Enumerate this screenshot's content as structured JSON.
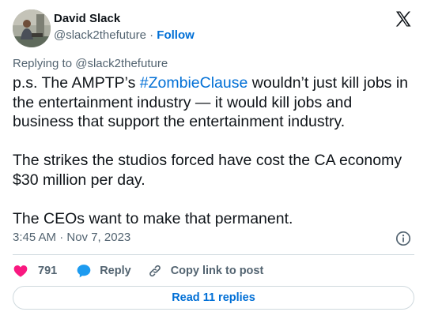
{
  "author": {
    "name": "David Slack",
    "handle": "@slack2thefuture",
    "separator": "·",
    "follow_label": "Follow"
  },
  "replying_to": "Replying to @slack2thefuture",
  "tweet": {
    "line1_prefix": "p.s. The AMPTP’s ",
    "hashtag": "#ZombieClause",
    "line1_suffix": " wouldn’t just kill jobs in the entertainment industry — it would kill jobs and business that support the entertainment industry.",
    "paragraph2": "The strikes the studios forced have cost the CA economy $30 million per day.",
    "paragraph3": "The CEOs want to make that permanent."
  },
  "timestamp": "3:45 AM · Nov 7, 2023",
  "actions": {
    "like_count": "791",
    "reply_label": "Reply",
    "copy_label": "Copy link to post"
  },
  "read_replies_label": "Read 11 replies",
  "colors": {
    "link": "#006fd6",
    "secondary_text": "#536471",
    "like_heart": "#f91880",
    "reply_bubble": "#1d9bf0",
    "border": "#cfd9de"
  },
  "icons": {
    "brand": "x-logo-icon",
    "info": "info-icon",
    "like": "heart-icon",
    "reply": "speech-bubble-icon",
    "copy": "link-icon"
  }
}
